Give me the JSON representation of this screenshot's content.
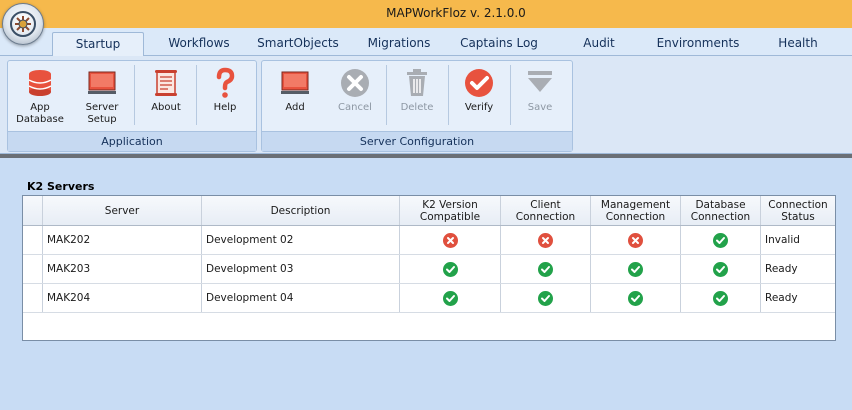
{
  "window": {
    "title": "MAPWorkFloz  v. 2.1.0.0"
  },
  "tabs": [
    {
      "label": "Startup",
      "active": true
    },
    {
      "label": "Workflows"
    },
    {
      "label": "SmartObjects"
    },
    {
      "label": "Migrations"
    },
    {
      "label": "Captains Log"
    },
    {
      "label": "Audit"
    },
    {
      "label": "Environments"
    },
    {
      "label": "Health"
    }
  ],
  "ribbon": {
    "application": {
      "label": "Application",
      "buttons": [
        {
          "label": "App\nDatabase",
          "icon": "database-icon"
        },
        {
          "label": "Server\nSetup",
          "icon": "monitor-icon"
        },
        {
          "label": "About",
          "icon": "scroll-icon"
        },
        {
          "label": "Help",
          "icon": "question-icon"
        }
      ]
    },
    "server_config": {
      "label": "Server Configuration",
      "buttons": [
        {
          "label": "Add",
          "icon": "monitor-icon",
          "enabled": true
        },
        {
          "label": "Cancel",
          "icon": "cancel-icon",
          "enabled": false
        },
        {
          "label": "Delete",
          "icon": "trash-icon",
          "enabled": false
        },
        {
          "label": "Verify",
          "icon": "check-icon",
          "enabled": true
        },
        {
          "label": "Save",
          "icon": "save-arrow-icon",
          "enabled": false
        }
      ]
    }
  },
  "servers": {
    "title": "K2 Servers",
    "columns": [
      "Server",
      "Description",
      "K2 Version\nCompatible",
      "Client\nConnection",
      "Management\nConnection",
      "Database\nConnection",
      "Connection\nStatus"
    ],
    "rows": [
      {
        "server": "MAK202",
        "description": "Development 02",
        "k2": "fail",
        "client": "fail",
        "mgmt": "fail",
        "db": "ok",
        "status": "Invalid"
      },
      {
        "server": "MAK203",
        "description": "Development 03",
        "k2": "ok",
        "client": "ok",
        "mgmt": "ok",
        "db": "ok",
        "status": "Ready"
      },
      {
        "server": "MAK204",
        "description": "Development 04",
        "k2": "ok",
        "client": "ok",
        "mgmt": "ok",
        "db": "ok",
        "status": "Ready"
      }
    ]
  },
  "colors": {
    "titlebar": "#f6b94c",
    "ok": "#22a24a",
    "fail": "#e0503e",
    "background": "#c8dcf4"
  }
}
